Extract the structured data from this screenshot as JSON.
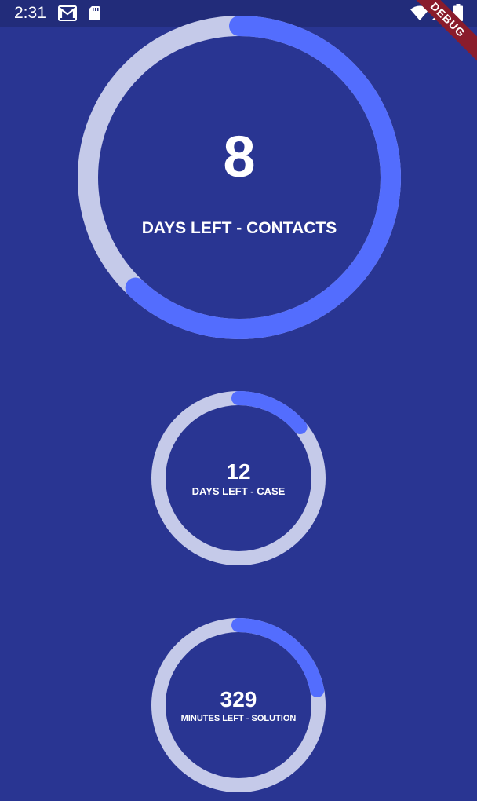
{
  "status_bar": {
    "time": "2:31",
    "icons": [
      "gmail-icon",
      "sd-card-icon",
      "wifi-icon",
      "cell-signal-icon",
      "battery-icon"
    ]
  },
  "debug_banner": {
    "label": "DEBUG"
  },
  "colors": {
    "background": "#293592",
    "status_bar": "#222c7a",
    "track": "#c5cae9",
    "progress": "#536dfe",
    "text": "#ffffff"
  },
  "counters": [
    {
      "value": "8",
      "label": "DAYS LEFT - CONTACTS",
      "progress": 0.62
    },
    {
      "value": "12",
      "label": "DAYS LEFT - CASE",
      "progress": 0.14
    },
    {
      "value": "329",
      "label": "MINUTES LEFT - SOLUTION",
      "progress": 0.22
    }
  ]
}
